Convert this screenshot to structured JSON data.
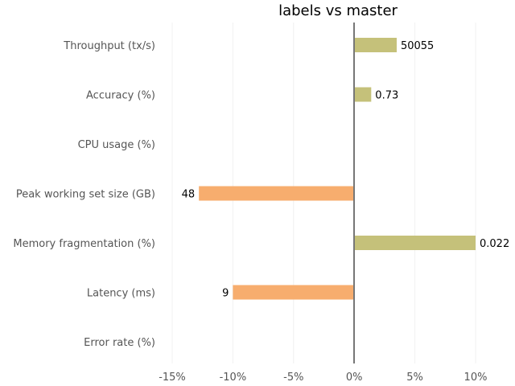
{
  "chart_data": {
    "type": "bar",
    "orientation": "horizontal",
    "title": "labels vs master",
    "xlabel": "",
    "ylabel": "",
    "xlim": [
      -15,
      10
    ],
    "ticks": [
      "-15%",
      "-10%",
      "-5%",
      "0%",
      "5%",
      "10%"
    ],
    "tick_values": [
      -15,
      -10,
      -5,
      0,
      5,
      10
    ],
    "grid": true,
    "categories": [
      "Throughput (tx/s)",
      "Accuracy (%)",
      "CPU usage (%)",
      "Peak working set size (GB)",
      "Memory fragmentation (%)",
      "Latency (ms)",
      "Error rate (%)"
    ],
    "values": [
      3.5,
      1.4,
      null,
      -12.8,
      10.0,
      -10.0,
      null
    ],
    "data_labels": [
      "50055",
      "0.73",
      "",
      "48",
      "0.022",
      "9",
      ""
    ],
    "colors": {
      "positive": "#c5c17a",
      "negative": "#f7ad6e",
      "zero_line": "#777777"
    }
  }
}
